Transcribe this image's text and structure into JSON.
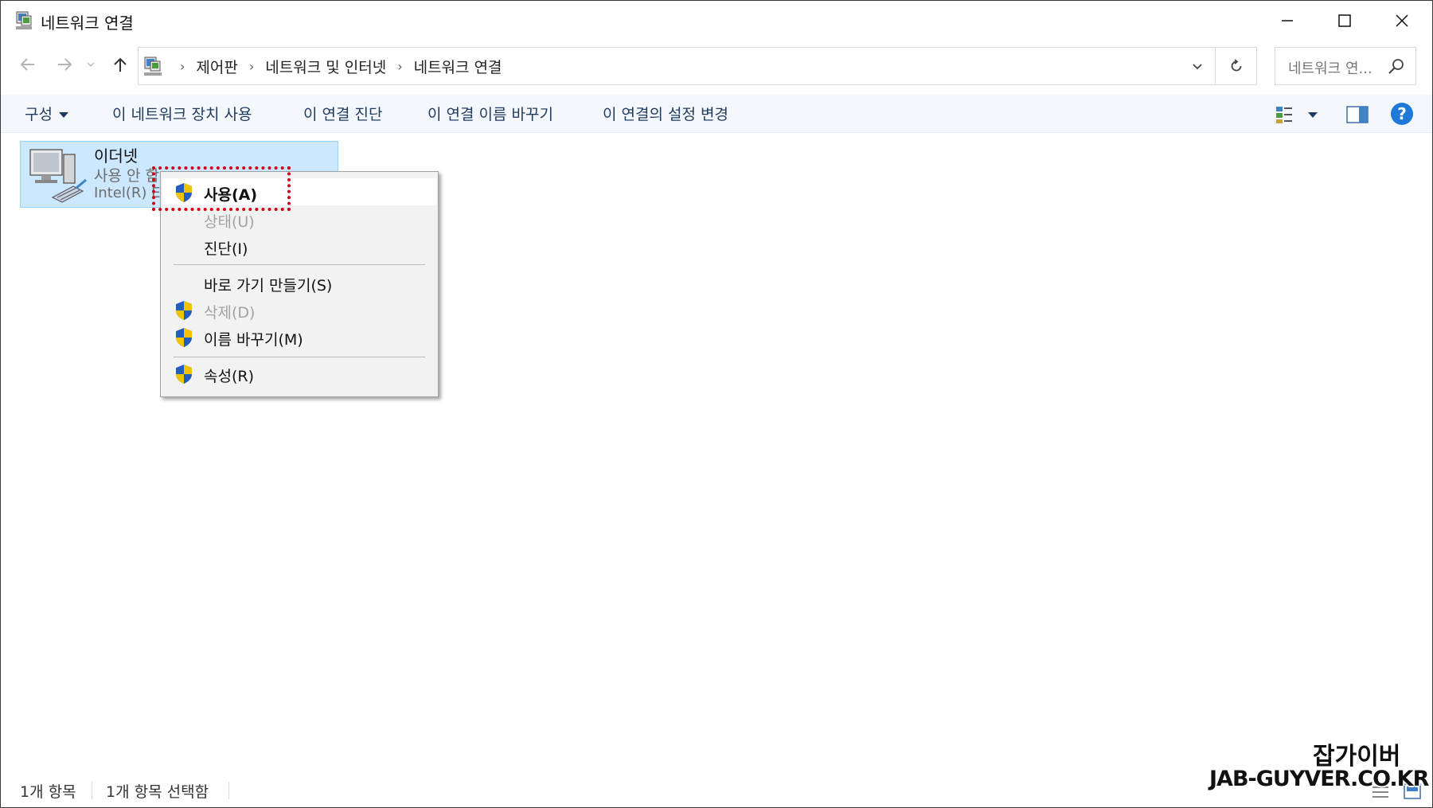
{
  "window": {
    "title": "네트워크 연결"
  },
  "address_bar": {
    "breadcrumbs": [
      "제어판",
      "네트워크 및 인터넷",
      "네트워크 연결"
    ],
    "separator": "›",
    "search_placeholder": "네트워크 연..."
  },
  "command_bar": {
    "organize": "구성",
    "enable_device": "이 네트워크 장치 사용",
    "diagnose": "이 연결 진단",
    "rename": "이 연결 이름 바꾸기",
    "change_settings": "이 연결의 설정 변경",
    "help": "?"
  },
  "item": {
    "name": "이더넷",
    "status": "사용 안 함",
    "device": "Intel(R) Ethernet Connection"
  },
  "context_menu": {
    "items": [
      {
        "label": "사용(A)",
        "shield": true,
        "disabled": false
      },
      {
        "label": "상태(U)",
        "shield": false,
        "disabled": true
      },
      {
        "label": "진단(I)",
        "shield": false,
        "disabled": false
      },
      {
        "label": "바로 가기 만들기(S)",
        "shield": false,
        "disabled": false
      },
      {
        "label": "삭제(D)",
        "shield": true,
        "disabled": true
      },
      {
        "label": "이름 바꾸기(M)",
        "shield": true,
        "disabled": false
      },
      {
        "label": "속성(R)",
        "shield": true,
        "disabled": false
      }
    ]
  },
  "status_bar": {
    "count": "1개 항목",
    "selected": "1개 항목 선택함"
  },
  "watermark": {
    "line1": "잡가이버",
    "line2": "JAB-GUYVER.CO.KR"
  },
  "colors": {
    "accent": "#1e7ad6",
    "selection": "#cce8ff",
    "annotation": "#d0021b"
  }
}
